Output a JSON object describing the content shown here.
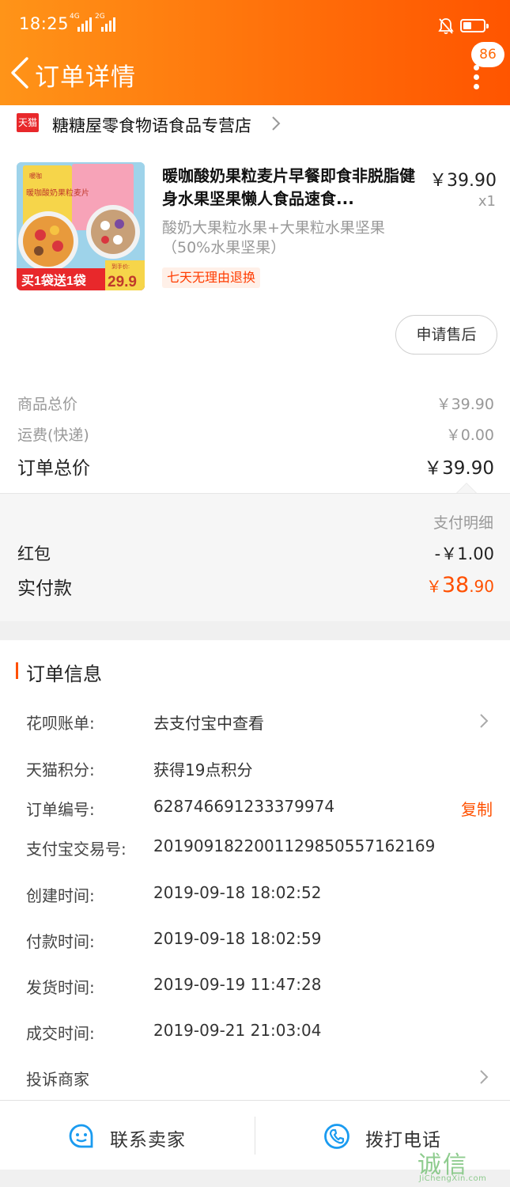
{
  "status_bar": {
    "time": "18:25",
    "net1": "4G",
    "net2": "2G"
  },
  "header": {
    "title": "订单详情",
    "badge": "86"
  },
  "store": {
    "badge": "天猫",
    "name": "糖糖屋零食物语食品专营店"
  },
  "product": {
    "title": "暖咖酸奶果粒麦片早餐即食非脱脂健身水果坚果懒人食品速食...",
    "price": "￥39.90",
    "qty": "x1",
    "sku": "酸奶大果粒水果+大果粒水果坚果（50%水果坚果）",
    "return_tag": "七天无理由退换",
    "image": {
      "brand": "暖咖",
      "name": "暖咖酸奶果粒麦片",
      "promo": "买1袋送1袋",
      "price_label": "到手价:",
      "price": "29.9"
    }
  },
  "actions": {
    "after_sale": "申请售后"
  },
  "totals": {
    "goods_label": "商品总价",
    "goods": "￥39.90",
    "shipping_label": "运费(快递)",
    "shipping": "￥0.00",
    "order_label": "订单总价",
    "order": "￥39.90"
  },
  "payment": {
    "detail_label": "支付明细",
    "redpacket_label": "红包",
    "redpacket": "-￥1.00",
    "actual_label": "实付款",
    "actual_symbol": "￥",
    "actual_int": "38",
    "actual_dec": ".90"
  },
  "order_info": {
    "title": "订单信息",
    "rows": [
      {
        "key": "花呗账单:",
        "value": "去支付宝中查看"
      },
      {
        "key": "天猫积分:",
        "value": "获得19点积分"
      },
      {
        "key": "订单编号:",
        "value": "628746691233379974",
        "action": "复制"
      },
      {
        "key": "支付宝交易号:",
        "value": "2019091822001129850557162169"
      },
      {
        "key": "创建时间:",
        "value": "2019-09-18 18:02:52"
      },
      {
        "key": "付款时间:",
        "value": "2019-09-18 18:02:59"
      },
      {
        "key": "发货时间:",
        "value": "2019-09-19 11:47:28"
      },
      {
        "key": "成交时间:",
        "value": "2019-09-21 21:03:04"
      }
    ],
    "complaint": "投诉商家"
  },
  "bottom_bar": {
    "contact": "联系卖家",
    "call": "拨打电话"
  },
  "watermark": {
    "logo": "诚信",
    "sub": "JiChengXin.com"
  },
  "colors": {
    "accent": "#ff5000",
    "header_start": "#ff9418",
    "header_end": "#ff5500",
    "tmall_red": "#e8282b",
    "icon_blue": "#1a9bf0"
  }
}
